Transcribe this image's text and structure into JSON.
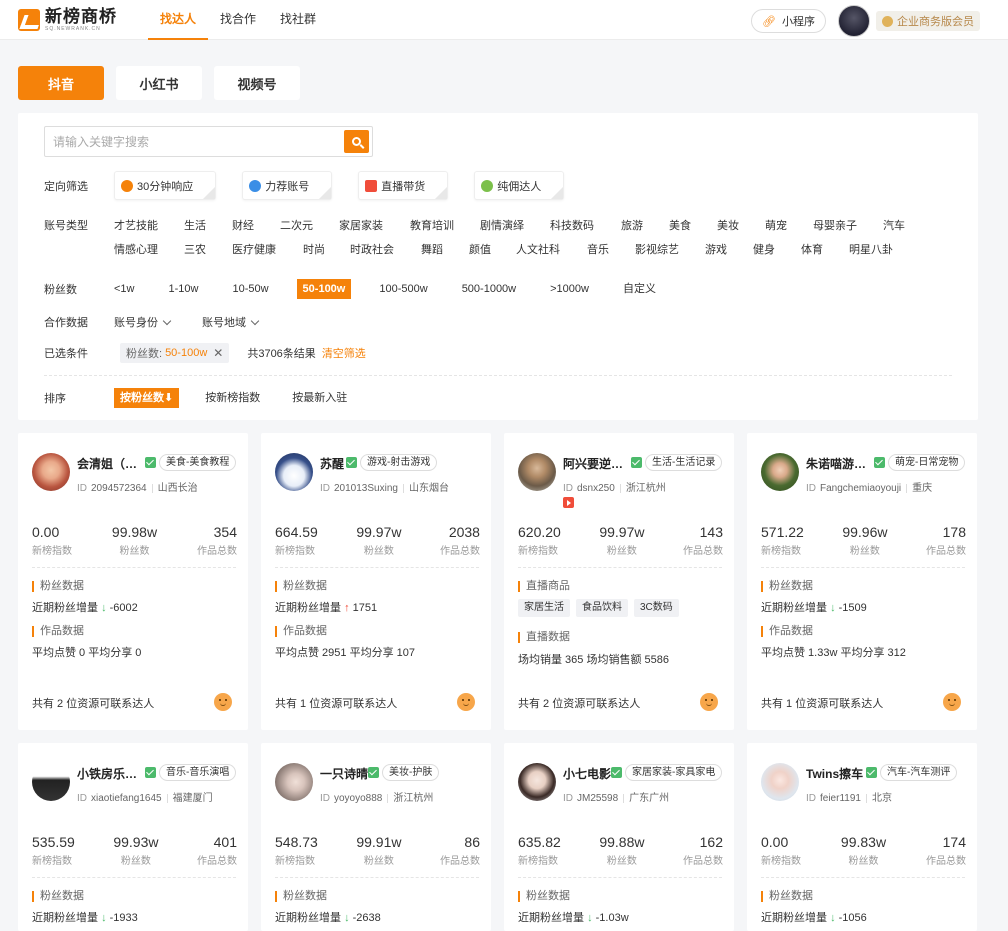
{
  "header": {
    "logo_name": "新榜商桥",
    "logo_sub": "SQ.NEWRANK.CN",
    "nav": [
      "找达人",
      "找合作",
      "找社群"
    ],
    "mini_program": "小程序",
    "vip": "企业商务版会员"
  },
  "platforms": [
    "抖音",
    "小红书",
    "视频号"
  ],
  "filters": {
    "search_placeholder": "请输入关键字搜索",
    "directed_label": "定向筛选",
    "directed": [
      {
        "label": "30分钟响应",
        "color": "#f5820a"
      },
      {
        "label": "力荐账号",
        "color": "#3a8ee6"
      },
      {
        "label": "直播带货",
        "color": "#f04d3a"
      },
      {
        "label": "纯佣达人",
        "color": "#7cc04b"
      }
    ],
    "type_label": "账号类型",
    "types_row1": [
      "才艺技能",
      "生活",
      "财经",
      "二次元",
      "家居家装",
      "教育培训",
      "剧情演绎",
      "科技数码",
      "旅游",
      "美食",
      "美妆",
      "萌宠",
      "母婴亲子",
      "汽车"
    ],
    "types_row2": [
      "情感心理",
      "三农",
      "医疗健康",
      "时尚",
      "时政社会",
      "舞蹈",
      "颜值",
      "人文社科",
      "音乐",
      "影视综艺",
      "游戏",
      "健身",
      "体育",
      "明星八卦"
    ],
    "fans_label": "粉丝数",
    "fans": [
      "<1w",
      "1-10w",
      "10-50w",
      "50-100w",
      "100-500w",
      "500-1000w",
      ">1000w",
      "自定义"
    ],
    "coop_label": "合作数据",
    "coop": [
      "账号身份",
      "账号地域"
    ],
    "selected_label": "已选条件",
    "chip_key": "粉丝数:",
    "chip_value": "50-100w",
    "total": "共3706条结果",
    "clear": "清空筛选",
    "sort_label": "排序",
    "sort": [
      "按粉丝数⬇",
      "按新榜指数",
      "按最新入驻"
    ]
  },
  "cards": [
    {
      "name": "会清姐（…",
      "tag": "美食-美食教程",
      "id": "2094572364",
      "region": "山西长治",
      "stats": [
        "0.00",
        "99.98w",
        "354"
      ],
      "stat_labels": [
        "新榜指数",
        "粉丝数",
        "作品总数"
      ],
      "sec1": "粉丝数据",
      "l1": "近期粉丝增量",
      "trend": "down",
      "inc": "-6002",
      "sec2": "作品数据",
      "l2": "平均点赞 0   平均分享 0",
      "foot": "共有 2 位资源可联系达人"
    },
    {
      "name": "苏醒",
      "tag": "游戏-射击游戏",
      "id": "201013Suxing",
      "region": "山东烟台",
      "stats": [
        "664.59",
        "99.97w",
        "2038"
      ],
      "stat_labels": [
        "新榜指数",
        "粉丝数",
        "作品总数"
      ],
      "sec1": "粉丝数据",
      "l1": "近期粉丝增量",
      "trend": "up",
      "inc": "1751",
      "sec2": "作品数据",
      "l2": "平均点赞 2951   平均分享 107",
      "foot": "共有 1 位资源可联系达人"
    },
    {
      "name": "阿兴要逆…",
      "tag": "生活-生活记录",
      "id": "dsnx250",
      "region": "浙江杭州",
      "stats": [
        "620.20",
        "99.97w",
        "143"
      ],
      "stat_labels": [
        "新榜指数",
        "粉丝数",
        "作品总数"
      ],
      "sec1": "直播商品",
      "goods": [
        "家居生活",
        "食品饮料",
        "3C数码"
      ],
      "sec2": "直播数据",
      "l2": "场均销量 365   场均销售额 5586",
      "foot": "共有 2 位资源可联系达人"
    },
    {
      "name": "朱诺喵游…",
      "tag": "萌宠-日常宠物",
      "id": "Fangchemiaoyouji",
      "region": "重庆",
      "stats": [
        "571.22",
        "99.96w",
        "178"
      ],
      "stat_labels": [
        "新榜指数",
        "粉丝数",
        "作品总数"
      ],
      "sec1": "粉丝数据",
      "l1": "近期粉丝增量",
      "trend": "down",
      "inc": "-1509",
      "sec2": "作品数据",
      "l2": "平均点赞 1.33w   平均分享 312",
      "foot": "共有 1 位资源可联系达人"
    },
    {
      "name": "小铁房乐…",
      "tag": "音乐-音乐演唱",
      "id": "xiaotiefang1645",
      "region": "福建厦门",
      "stats": [
        "535.59",
        "99.93w",
        "401"
      ],
      "stat_labels": [
        "新榜指数",
        "粉丝数",
        "作品总数"
      ],
      "sec1": "粉丝数据",
      "l1": "近期粉丝增量",
      "trend": "down",
      "inc": "-1933"
    },
    {
      "name": "一只诗晴",
      "tag": "美妆-护肤",
      "id": "yoyoyo888",
      "region": "浙江杭州",
      "stats": [
        "548.73",
        "99.91w",
        "86"
      ],
      "stat_labels": [
        "新榜指数",
        "粉丝数",
        "作品总数"
      ],
      "sec1": "粉丝数据",
      "l1": "近期粉丝增量",
      "trend": "down",
      "inc": "-2638"
    },
    {
      "name": "小七电影",
      "tag": "家居家装-家具家电",
      "id": "JM25598",
      "region": "广东广州",
      "stats": [
        "635.82",
        "99.88w",
        "162"
      ],
      "stat_labels": [
        "新榜指数",
        "粉丝数",
        "作品总数"
      ],
      "sec1": "粉丝数据",
      "l1": "近期粉丝增量",
      "trend": "down",
      "inc": "-1.03w"
    },
    {
      "name": "Twins擦车",
      "tag": "汽车-汽车测评",
      "id": "feier1191",
      "region": "北京",
      "stats": [
        "0.00",
        "99.83w",
        "174"
      ],
      "stat_labels": [
        "新榜指数",
        "粉丝数",
        "作品总数"
      ],
      "sec1": "粉丝数据",
      "l1": "近期粉丝增量",
      "trend": "down",
      "inc": "-1056"
    }
  ]
}
